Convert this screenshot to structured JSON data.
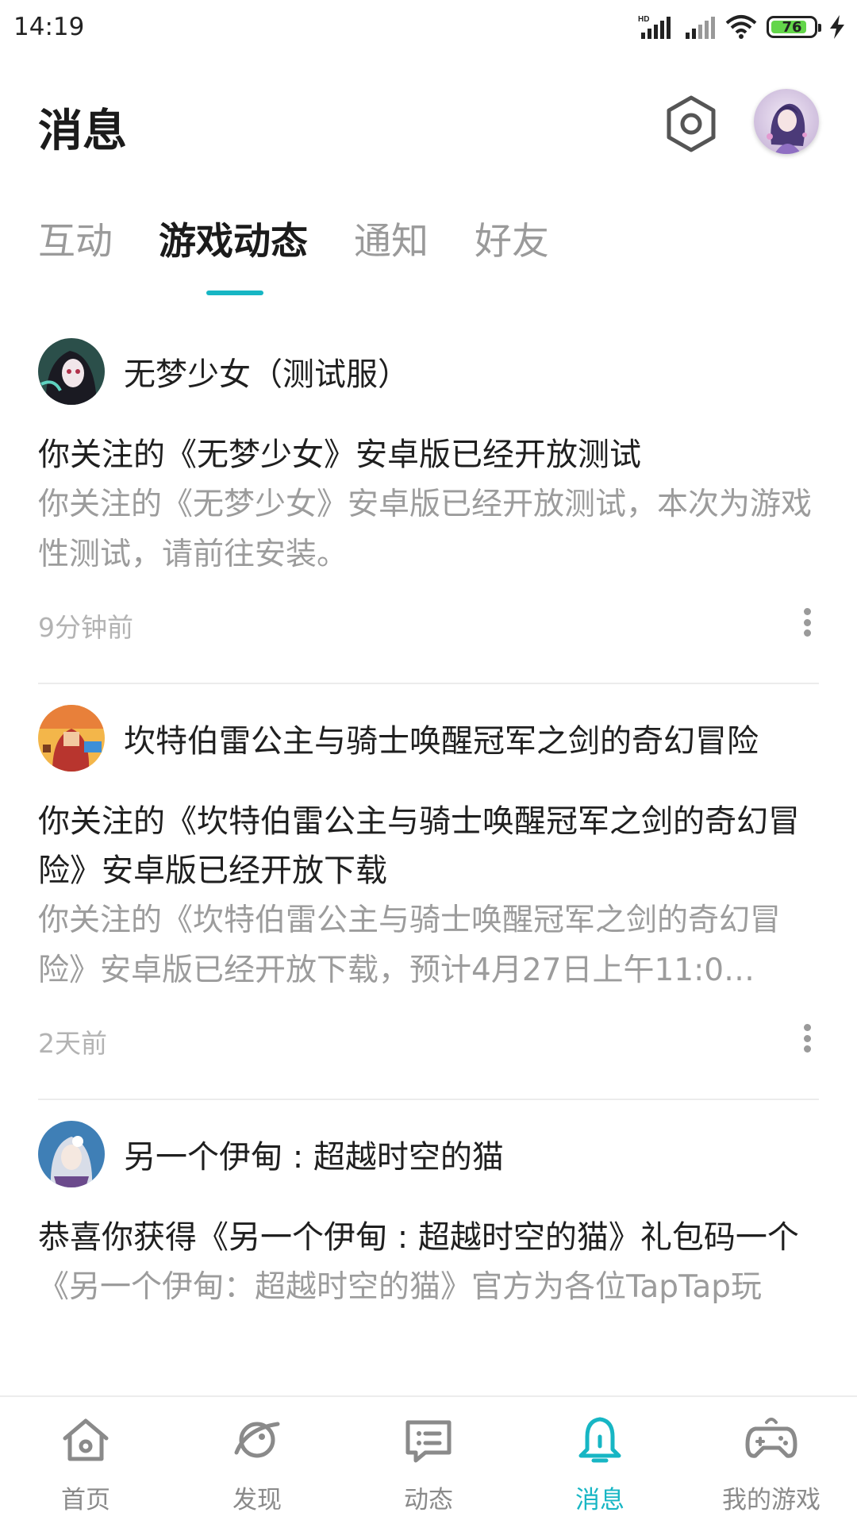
{
  "status_bar": {
    "time": "14:19",
    "network_badge": "HD",
    "battery_level": "76"
  },
  "header": {
    "title": "消息"
  },
  "tabs": [
    {
      "label": "互动",
      "active": false
    },
    {
      "label": "游戏动态",
      "active": true
    },
    {
      "label": "通知",
      "active": false
    },
    {
      "label": "好友",
      "active": false
    }
  ],
  "feed": {
    "items": [
      {
        "game": "无梦少女（测试服）",
        "title": "你关注的《无梦少女》安卓版已经开放测试",
        "body": "你关注的《无梦少女》安卓版已经开放测试，本次为游戏性测试，请前往安装。",
        "time": "9分钟前"
      },
      {
        "game": "坎特伯雷公主与骑士唤醒冠军之剑的奇幻冒险",
        "title": "你关注的《坎特伯雷公主与骑士唤醒冠军之剑的奇幻冒险》安卓版已经开放下载",
        "body": "你关注的《坎特伯雷公主与骑士唤醒冠军之剑的奇幻冒险》安卓版已经开放下载，预计4月27日上午11:0…",
        "time": "2天前"
      },
      {
        "game": "另一个伊甸 : 超越时空的猫",
        "title": "恭喜你获得《另一个伊甸 : 超越时空的猫》礼包码一个",
        "body": "《另一个伊甸：超越时空的猫》官方为各位TapTap玩",
        "time": ""
      }
    ]
  },
  "bottom_nav": [
    {
      "label": "首页",
      "icon": "home-icon",
      "active": false
    },
    {
      "label": "发现",
      "icon": "discover-icon",
      "active": false
    },
    {
      "label": "动态",
      "icon": "feed-icon",
      "active": false
    },
    {
      "label": "消息",
      "icon": "bell-icon",
      "active": true
    },
    {
      "label": "我的游戏",
      "icon": "gamepad-icon",
      "active": false
    }
  ],
  "colors": {
    "accent": "#17b6c4",
    "text_primary": "#1f1f1f",
    "text_secondary": "#9c9c9c"
  }
}
